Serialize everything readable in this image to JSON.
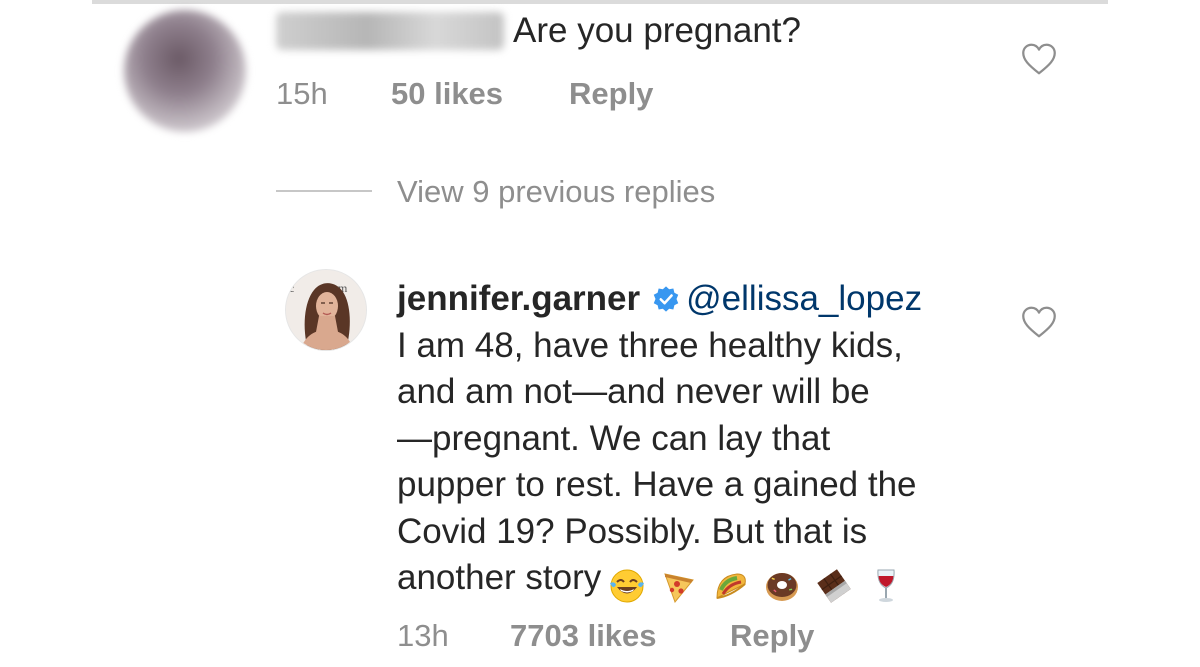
{
  "comment_1": {
    "text": "Are you pregnant?",
    "time": "15h",
    "likes": "50 likes",
    "reply_label": "Reply"
  },
  "view_replies_label": "View 9 previous replies",
  "reply_comment": {
    "author": "jennifer.garner",
    "mention": "@ellissa_lopez",
    "lines": [
      "I am 48, have three healthy kids,",
      "and am not—and never will be",
      "—pregnant. We can lay that",
      "pupper to rest. Have a gained the",
      "Covid 19?  Possibly.  But that is",
      "another story"
    ],
    "emojis": [
      "tears-of-joy-emoji",
      "pizza-emoji",
      "taco-emoji",
      "doughnut-emoji",
      "chocolate-bar-emoji",
      "wine-glass-emoji"
    ],
    "time": "13h",
    "likes": "7703 likes",
    "reply_label": "Reply"
  },
  "colors": {
    "text": "#262626",
    "secondary": "#8e8e8e",
    "mention": "#00376b",
    "verified": "#3897f0"
  }
}
